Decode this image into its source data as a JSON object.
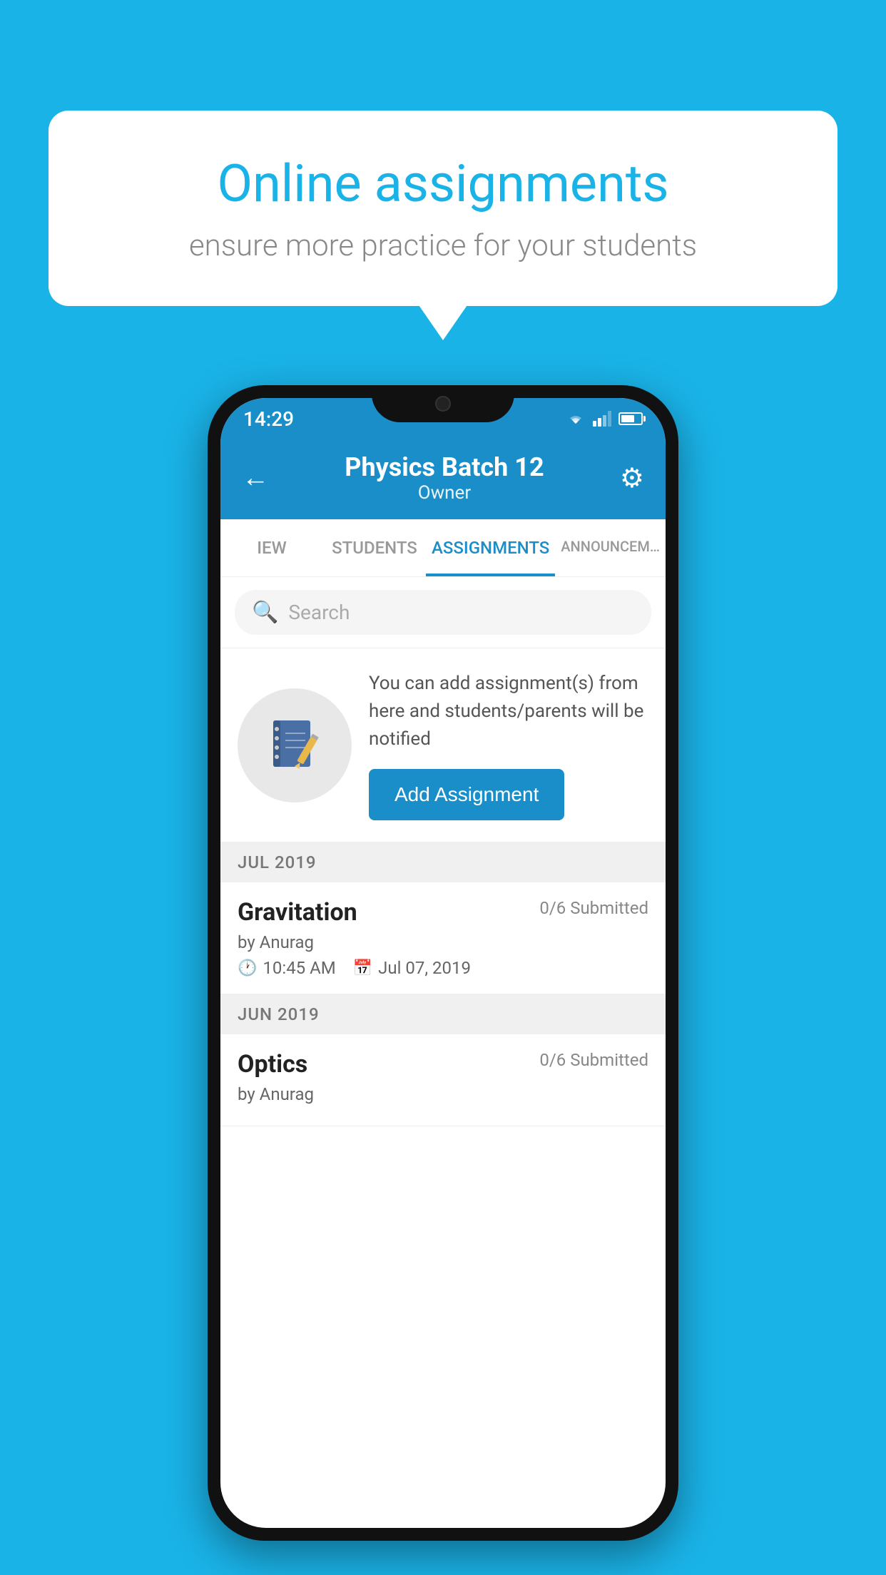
{
  "background_color": "#1ab3e8",
  "speech_bubble": {
    "title": "Online assignments",
    "subtitle": "ensure more practice for your students"
  },
  "phone": {
    "status_bar": {
      "time": "14:29"
    },
    "header": {
      "title": "Physics Batch 12",
      "subtitle": "Owner",
      "back_label": "←",
      "settings_label": "⚙"
    },
    "tabs": [
      {
        "label": "IEW",
        "active": false
      },
      {
        "label": "STUDENTS",
        "active": false
      },
      {
        "label": "ASSIGNMENTS",
        "active": true
      },
      {
        "label": "ANNOUNCEM…",
        "active": false
      }
    ],
    "search": {
      "placeholder": "Search"
    },
    "promo": {
      "text": "You can add assignment(s) from here and students/parents will be notified",
      "button_label": "Add Assignment"
    },
    "sections": [
      {
        "header": "JUL 2019",
        "assignments": [
          {
            "title": "Gravitation",
            "submitted": "0/6 Submitted",
            "by": "by Anurag",
            "time": "10:45 AM",
            "date": "Jul 07, 2019"
          }
        ]
      },
      {
        "header": "JUN 2019",
        "assignments": [
          {
            "title": "Optics",
            "submitted": "0/6 Submitted",
            "by": "by Anurag",
            "time": "",
            "date": ""
          }
        ]
      }
    ]
  }
}
